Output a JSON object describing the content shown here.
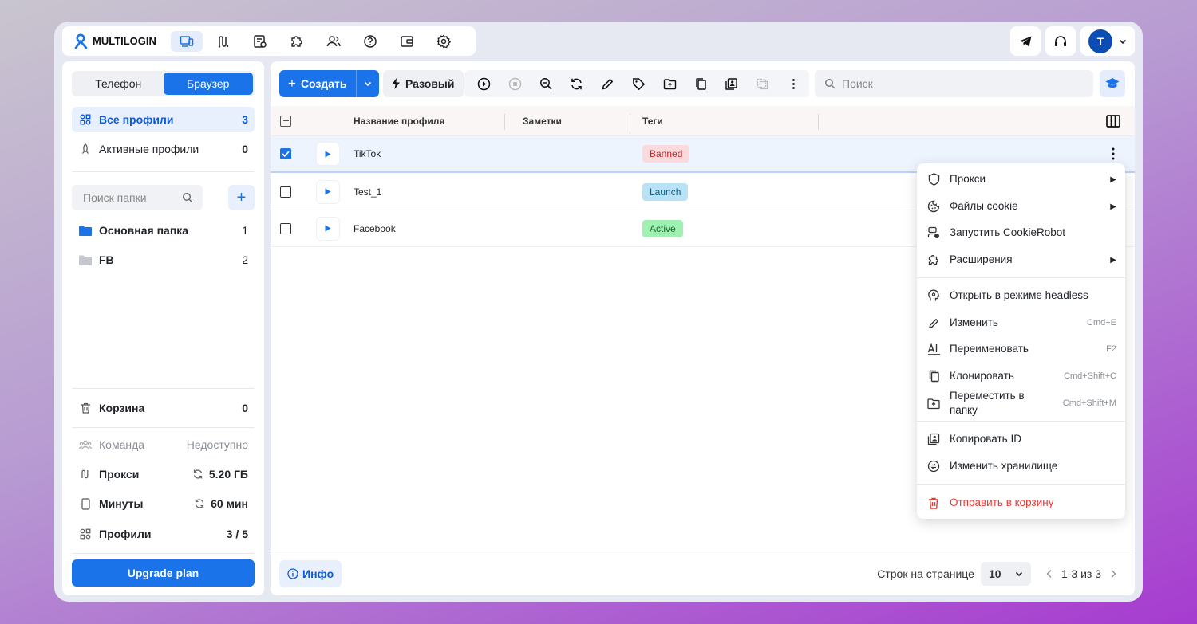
{
  "app": {
    "brand": "MULTILOGIN"
  },
  "topbar": {
    "nav_icons": [
      "profiles-icon",
      "proxy-icon",
      "scripts-icon",
      "extensions-icon",
      "team-icon",
      "help-icon",
      "wallet-icon",
      "settings-icon"
    ],
    "avatar_letter": "T"
  },
  "sidebar": {
    "segment": {
      "phone": "Телефон",
      "browser": "Браузер",
      "selected": "Браузер"
    },
    "all_profiles": {
      "label": "Все профили",
      "count": "3"
    },
    "active_profiles": {
      "label": "Активные профили",
      "count": "0"
    },
    "folder_search_placeholder": "Поиск папки",
    "folders": [
      {
        "label": "Основная папка",
        "count": "1",
        "color": "#1a73e8"
      },
      {
        "label": "FB",
        "count": "2",
        "color": "#c4c7cd"
      }
    ],
    "trash": {
      "label": "Корзина",
      "count": "0"
    },
    "team": {
      "label": "Команда",
      "value": "Недоступно"
    },
    "proxy": {
      "label": "Прокси",
      "value": "5.20 ГБ"
    },
    "minutes": {
      "label": "Минуты",
      "value": "60 мин"
    },
    "profiles": {
      "label": "Профили",
      "value": "3 / 5"
    },
    "upgrade_label": "Upgrade plan"
  },
  "toolbar": {
    "create_label": "Создать",
    "once_label": "Разовый",
    "search_placeholder": "Поиск"
  },
  "table": {
    "headers": {
      "name": "Название профиля",
      "notes": "Заметки",
      "tags": "Теги"
    },
    "rows": [
      {
        "name": "TikTok",
        "tag": "Banned",
        "tag_bg": "#fadadd",
        "tag_fg": "#c62828",
        "checked": true
      },
      {
        "name": "Test_1",
        "tag": "Launch",
        "tag_bg": "#b8e3f7",
        "tag_fg": "#0b5a80",
        "checked": false
      },
      {
        "name": "Facebook",
        "tag": "Active",
        "tag_bg": "#9ff0b1",
        "tag_fg": "#136b2c",
        "checked": false
      }
    ]
  },
  "footer": {
    "info_label": "Инфо",
    "rows_per_page_label": "Строк на странице",
    "rows_per_page_value": "10",
    "range": "1-3 из 3"
  },
  "context_menu": {
    "proxy": "Прокси",
    "cookies": "Файлы cookie",
    "cookierobot": "Запустить CookieRobot",
    "extensions": "Расширения",
    "headless": "Открыть в режиме headless",
    "edit": "Изменить",
    "edit_shortcut": "Cmd+E",
    "rename": "Переименовать",
    "rename_shortcut": "F2",
    "clone": "Клонировать",
    "clone_shortcut": "Cmd+Shift+C",
    "move_line1": "Переместить в",
    "move_line2": "папку",
    "move_shortcut": "Cmd+Shift+M",
    "copy_id": "Копировать ID",
    "storage": "Изменить хранилище",
    "trash": "Отправить в корзину",
    "trash_color": "#e53935"
  }
}
